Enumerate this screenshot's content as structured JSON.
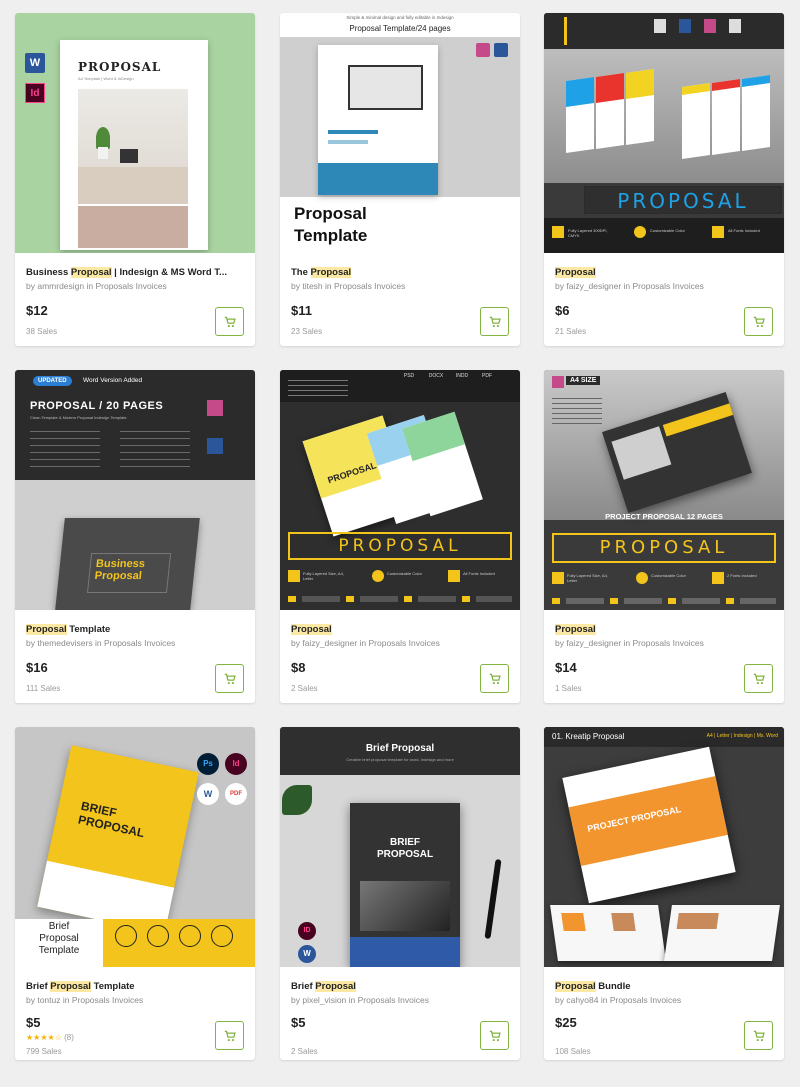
{
  "cards": [
    {
      "title_pre": "Business ",
      "title_hl": "Proposal",
      "title_post": " | Indesign & MS Word T...",
      "author": "ammrdesign",
      "category": "Proposals Invoices",
      "price": "$12",
      "sales": "38 Sales",
      "thumb": {
        "heading": "PROPOSAL",
        "sub": "A4 Template | Word & InDesign",
        "bg": "#a9d3a1",
        "icons": [
          "W",
          "Id"
        ]
      }
    },
    {
      "title_pre": "The ",
      "title_hl": "Proposal",
      "title_post": "",
      "author": "titesh",
      "category": "Proposals Invoices",
      "price": "$11",
      "sales": "23 Sales",
      "thumb": {
        "top_note": "Simple & minimal design and fully editable in Indesign",
        "top_title": "Proposal Template/24 pages",
        "heading_line1": "Proposal",
        "heading_line2": "Template"
      }
    },
    {
      "title_pre": "",
      "title_hl": "Proposal",
      "title_post": "",
      "author": "faizy_designer",
      "category": "Proposals Invoices",
      "price": "$6",
      "sales": "21 Sales",
      "thumb": {
        "banner": "PROPOSAL",
        "features": [
          "Fully Layered 300DPI, CMYK",
          "Customizable Color",
          "All Fonts Included"
        ]
      }
    },
    {
      "title_pre": "",
      "title_hl": "Proposal",
      "title_post": " Template",
      "author": "themedevisers",
      "category": "Proposals Invoices",
      "price": "$16",
      "sales": "111 Sales",
      "thumb": {
        "badge": "UPDATED",
        "badge_note": "Word Version Added",
        "heading": "PROPOSAL / 20 PAGES",
        "sub": "Clean Template & Modern Proposal Indesign Template",
        "cover_line1": "Business",
        "cover_line2": "Proposal"
      }
    },
    {
      "title_pre": "",
      "title_hl": "Proposal",
      "title_post": "",
      "author": "faizy_designer",
      "category": "Proposals Invoices",
      "price": "$8",
      "sales": "2 Sales",
      "thumb": {
        "banner": "PROPOSAL",
        "formats": [
          "PSD",
          "DOCX",
          "INDD",
          "PDF"
        ],
        "cover": "PROPOSAL",
        "features": [
          "Fully Layered Size, A4, Letter",
          "Customizable Color",
          "All Fonts Included"
        ]
      }
    },
    {
      "title_pre": "",
      "title_hl": "Proposal",
      "title_post": "",
      "author": "faizy_designer",
      "category": "Proposals Invoices",
      "price": "$14",
      "sales": "1 Sales",
      "thumb": {
        "tag": "A4 SIZE",
        "caption": "PROJECT PROPOSAL 12 PAGES",
        "banner": "PROPOSAL",
        "features": [
          "Fully Layered Size, A4, Letter",
          "Customizable Color",
          "2 Fonts Included"
        ]
      }
    },
    {
      "title_pre": "Brief ",
      "title_hl": "Proposal",
      "title_post": " Template",
      "author": "tontuz",
      "category": "Proposals Invoices",
      "price": "$5",
      "stars": "★★★★☆",
      "rating_count": "(8)",
      "sales": "799 Sales",
      "thumb": {
        "cover_line1": "BRIEF",
        "cover_line2": "PROPOSAL",
        "label_line1": "Brief",
        "label_line2": "Proposal",
        "label_line3": "Template",
        "icons": [
          "Ps",
          "Id",
          "W",
          "PDF"
        ]
      }
    },
    {
      "title_pre": "Brief ",
      "title_hl": "Proposal",
      "title_post": "",
      "author": "pixel_vision",
      "category": "Proposals Invoices",
      "price": "$5",
      "sales": "2 Sales",
      "thumb": {
        "heading": "Brief Proposal",
        "sub": "Creative brief proposal template for word, Indesign and more",
        "cover_line1": "BRIEF",
        "cover_line2": "PROPOSAL",
        "icons": [
          "ID",
          "W"
        ]
      }
    },
    {
      "title_pre": "",
      "title_hl": "Proposal",
      "title_post": " Bundle",
      "author": "cahyo84",
      "category": "Proposals Invoices",
      "price": "$25",
      "sales": "108 Sales",
      "thumb": {
        "heading": "01. Kreatip Proposal",
        "formats": "A4 | Letter | Indesign | Ms. Word",
        "cover": "PROJECT PROPOSAL"
      }
    }
  ],
  "labels": {
    "by": "by ",
    "in": " in "
  },
  "colors": {
    "accent_green": "#82b440",
    "highlight": "#fbe9a3",
    "yellow": "#f3c41b"
  }
}
